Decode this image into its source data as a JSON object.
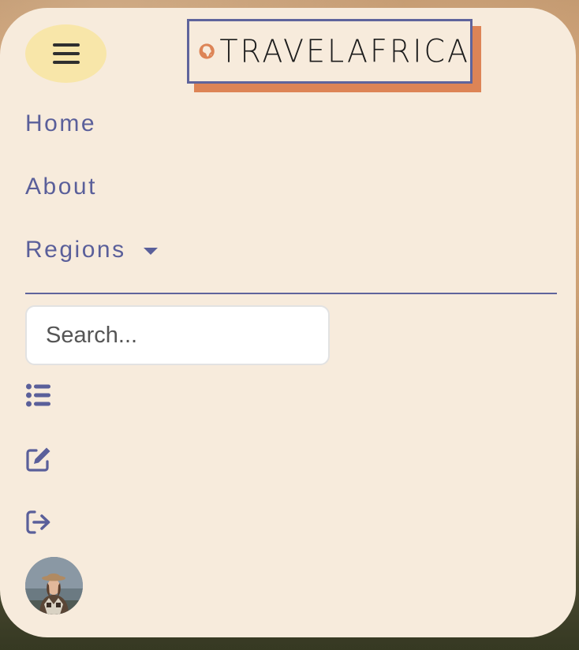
{
  "brand": {
    "name": "TRAVELAFRICA",
    "icon": "africa-globe-icon",
    "colors": {
      "frame": "#5f649c",
      "shadow": "#dd8456",
      "globe": "#dd8456"
    }
  },
  "menu_toggle": {
    "icon": "hamburger-icon"
  },
  "nav": {
    "home_label": "Home",
    "about_label": "About",
    "regions_label": "Regions"
  },
  "search": {
    "placeholder": "Search..."
  },
  "actions": [
    {
      "icon": "list-icon"
    },
    {
      "icon": "edit-icon"
    },
    {
      "icon": "logout-icon"
    }
  ],
  "profile": {
    "icon": "user-avatar"
  },
  "colors": {
    "panel_bg": "#f7ebdc",
    "accent_text": "#5a5f9a",
    "toggle_bg": "#f8e6a9"
  }
}
